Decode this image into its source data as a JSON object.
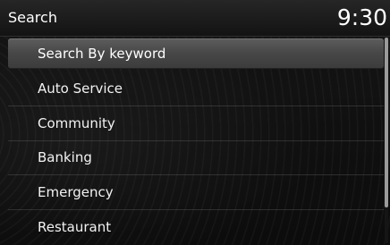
{
  "header": {
    "title": "Search",
    "clock": "9:30"
  },
  "menu": {
    "selected_index": 0,
    "items": [
      {
        "label": "Search By keyword"
      },
      {
        "label": "Auto Service"
      },
      {
        "label": "Community"
      },
      {
        "label": "Banking"
      },
      {
        "label": "Emergency"
      },
      {
        "label": "Restaurant"
      }
    ]
  },
  "colors": {
    "background": "#0b0b0b",
    "header": "#1c1c1c",
    "selected_row": "#4a4a4a",
    "text": "#ffffff",
    "scroll_thumb": "#9b9b9b"
  }
}
